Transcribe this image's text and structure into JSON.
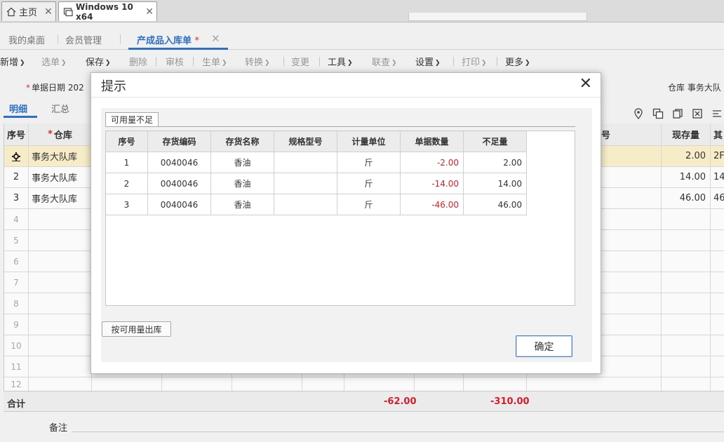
{
  "browser_tabs": [
    {
      "label": "主页",
      "active": false
    },
    {
      "label": "Windows 10 x64",
      "active": true
    }
  ],
  "app_tabs": [
    {
      "label": "我的桌面",
      "active": false
    },
    {
      "label": "会员管理",
      "active": false
    },
    {
      "label": "产成品入库单",
      "active": true,
      "modified_mark": "*"
    }
  ],
  "toolbar": {
    "add": "新增",
    "select": "选单",
    "save": "保存",
    "delete": "删除",
    "audit": "审核",
    "generate": "生单",
    "convert": "转换",
    "change": "变更",
    "tools": "工具",
    "link": "联查",
    "settings": "设置",
    "print": "打印",
    "more": "更多"
  },
  "header": {
    "date_label": "单据日期",
    "date_value": "202",
    "warehouse_label": "仓库",
    "warehouse_value": "事务大队"
  },
  "subtabs": {
    "detail": "明细",
    "summary": "汇总"
  },
  "grid": {
    "headers": {
      "row_no": "序号",
      "warehouse": "仓库",
      "batch_no": "号",
      "stock": "现存量",
      "extra": "其"
    },
    "rows": [
      {
        "no": "1",
        "warehouse": "事务大队库",
        "stock": "2.00",
        "extra": "2F"
      },
      {
        "no": "2",
        "warehouse": "事务大队库",
        "stock": "14.00",
        "extra": "14"
      },
      {
        "no": "3",
        "warehouse": "事务大队库",
        "stock": "46.00",
        "extra": "46"
      }
    ],
    "empty_rows": [
      "4",
      "5",
      "6",
      "7",
      "8",
      "9",
      "10",
      "11",
      "12"
    ],
    "total_label": "合计",
    "total_qty": "-62.00",
    "total_amount": "-310.00",
    "remark_label": "备注"
  },
  "modal": {
    "title": "提示",
    "inner_tab": "可用量不足",
    "columns": [
      "序号",
      "存货编码",
      "存货名称",
      "规格型号",
      "计量单位",
      "单据数量",
      "不足量"
    ],
    "rows": [
      {
        "no": "1",
        "code": "0040046",
        "name": "香油",
        "spec": "",
        "unit": "斤",
        "qty": "-2.00",
        "short": "2.00"
      },
      {
        "no": "2",
        "code": "0040046",
        "name": "香油",
        "spec": "",
        "unit": "斤",
        "qty": "-14.00",
        "short": "14.00"
      },
      {
        "no": "3",
        "code": "0040046",
        "name": "香油",
        "spec": "",
        "unit": "斤",
        "qty": "-46.00",
        "short": "46.00"
      }
    ],
    "avail_button": "按可用量出库",
    "ok_button": "确定"
  },
  "colors": {
    "accent": "#2f73c7",
    "negative": "#d8202a",
    "selected_row": "#fbf2cc"
  }
}
